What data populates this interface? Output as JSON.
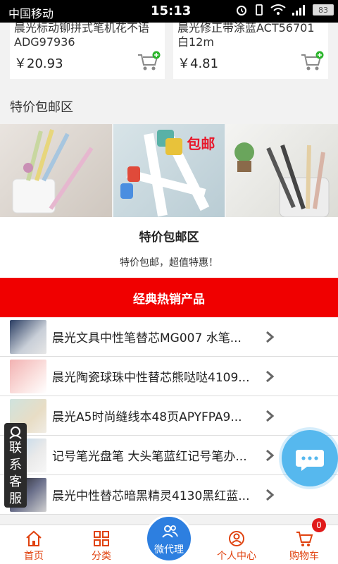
{
  "status_bar": {
    "carrier": "中国移动",
    "time": "15:13",
    "battery": "83"
  },
  "top_cards": [
    {
      "name": "晨光标动铆拼式笔机花不语ADG97936",
      "price": "￥20.93"
    },
    {
      "name": "晨光修正带涂蓝ACT56701白12m",
      "price": "￥4.81"
    }
  ],
  "special": {
    "section_title": "特价包邮区",
    "banner_badge": "包邮",
    "promo_title": "特价包邮区",
    "promo_subtitle": "特价包邮，超值特惠！"
  },
  "hot": {
    "header": "经典热销产品",
    "items": [
      {
        "title": "晨光文具中性笔替芯MG007 水笔..."
      },
      {
        "title": "晨光陶瓷球珠中性替芯熊哒哒4109..."
      },
      {
        "title": "晨光A5时尚缝线本48页APYFPA9..."
      },
      {
        "title": "记号笔光盘笔 大头笔蓝红记号笔办..."
      },
      {
        "title": "晨光中性替芯暗黑精灵4130黑红蓝..."
      }
    ]
  },
  "contact": {
    "label_chars": [
      "联",
      "系",
      "客",
      "服"
    ]
  },
  "nav": {
    "home": "首页",
    "category": "分类",
    "proxy": "微代理",
    "me": "个人中心",
    "cart": "购物车",
    "cart_count": "0"
  },
  "colors": {
    "accent": "#f00000",
    "nav": "#e0420f",
    "proxy": "#2d7fe0",
    "chat": "#56b8ee"
  }
}
